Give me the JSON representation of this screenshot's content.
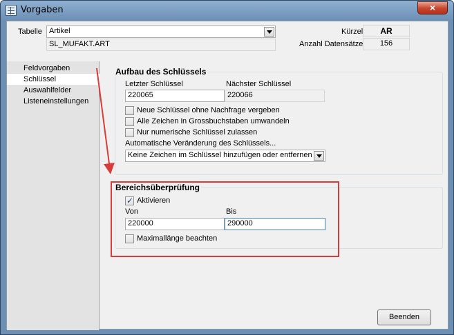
{
  "window": {
    "title": "Vorgaben",
    "close_glyph": "×"
  },
  "header": {
    "tabelle_label": "Tabelle",
    "tabelle_value": "Artikel",
    "file_value": "SL_MUFAKT.ART",
    "kuerzel_label": "Kürzel",
    "kuerzel_value": "AR",
    "anzahl_label": "Anzahl Datensätze",
    "anzahl_value": "156"
  },
  "sidebar": {
    "items": [
      {
        "label": "Feldvorgaben"
      },
      {
        "label": "Schlüssel"
      },
      {
        "label": "Auswahlfelder"
      },
      {
        "label": "Listeneinstellungen"
      }
    ]
  },
  "schluessel_group": {
    "title": "Aufbau des Schlüssels",
    "letzter_label": "Letzter Schlüssel",
    "letzter_value": "220065",
    "naechster_label": "Nächster Schlüssel",
    "naechster_value": "220066",
    "checks": [
      {
        "label": "Neue Schlüssel ohne Nachfrage vergeben",
        "checked": false
      },
      {
        "label": "Alle Zeichen in Grossbuchstaben umwandeln",
        "checked": false
      },
      {
        "label": "Nur numerische Schlüssel zulassen",
        "checked": false
      }
    ],
    "auto_label": "Automatische Veränderung des Schlüssels...",
    "auto_value": "Keine Zeichen im Schlüssel hinzufügen oder entfernen"
  },
  "bereich_group": {
    "title": "Bereichsüberprüfung",
    "aktivieren_label": "Aktivieren",
    "aktivieren_checked": true,
    "von_label": "Von",
    "von_value": "220000",
    "bis_label": "Bis",
    "bis_value": "290000",
    "max_label": "Maximallänge beachten",
    "max_checked": false
  },
  "footer": {
    "beenden_label": "Beenden"
  },
  "annotation_color": "#d93a3a"
}
